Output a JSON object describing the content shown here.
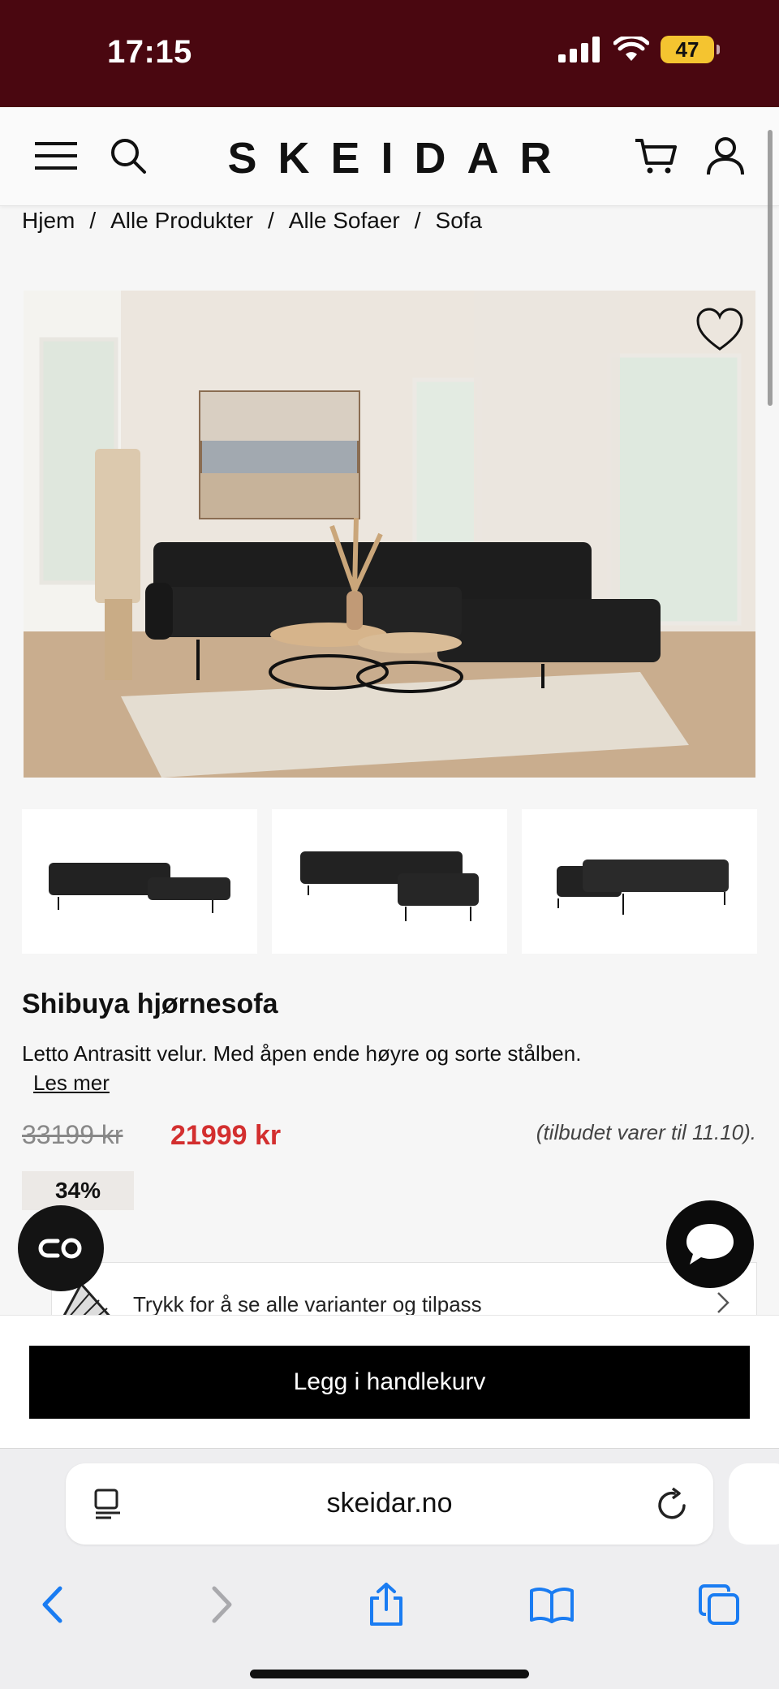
{
  "status": {
    "time": "17:15",
    "battery": "47"
  },
  "header": {
    "logo": "SKEIDAR"
  },
  "breadcrumb": [
    "Hjem",
    "Alle Produkter",
    "Alle Sofaer",
    "Sofa"
  ],
  "product": {
    "title": "Shibuya hjørnesofa",
    "description": "Letto Antrasitt velur. Med åpen ende høyre og sorte stålben.",
    "read_more": "Les mer",
    "price_old": "33199 kr",
    "price_new": "21999 kr",
    "offer_note": "(tilbudet varer til 11.10).",
    "discount": "34%"
  },
  "variants": {
    "label": "Trykk for å se alle varianter og tilpass"
  },
  "cart": {
    "button_label": "Legg i handlekurv"
  },
  "browser": {
    "url": "skeidar.no"
  },
  "colors": {
    "statusbar": "#4a0710",
    "price_new": "#d32f2f",
    "ios_blue": "#1a7cf2"
  },
  "icons": [
    "menu-icon",
    "search-icon",
    "cart-icon",
    "user-icon",
    "heart-icon",
    "chat-icon",
    "co-icon",
    "chevron-right-icon",
    "reader-icon",
    "reload-icon",
    "back-icon",
    "forward-icon",
    "share-icon",
    "bookmarks-icon",
    "tabs-icon"
  ]
}
